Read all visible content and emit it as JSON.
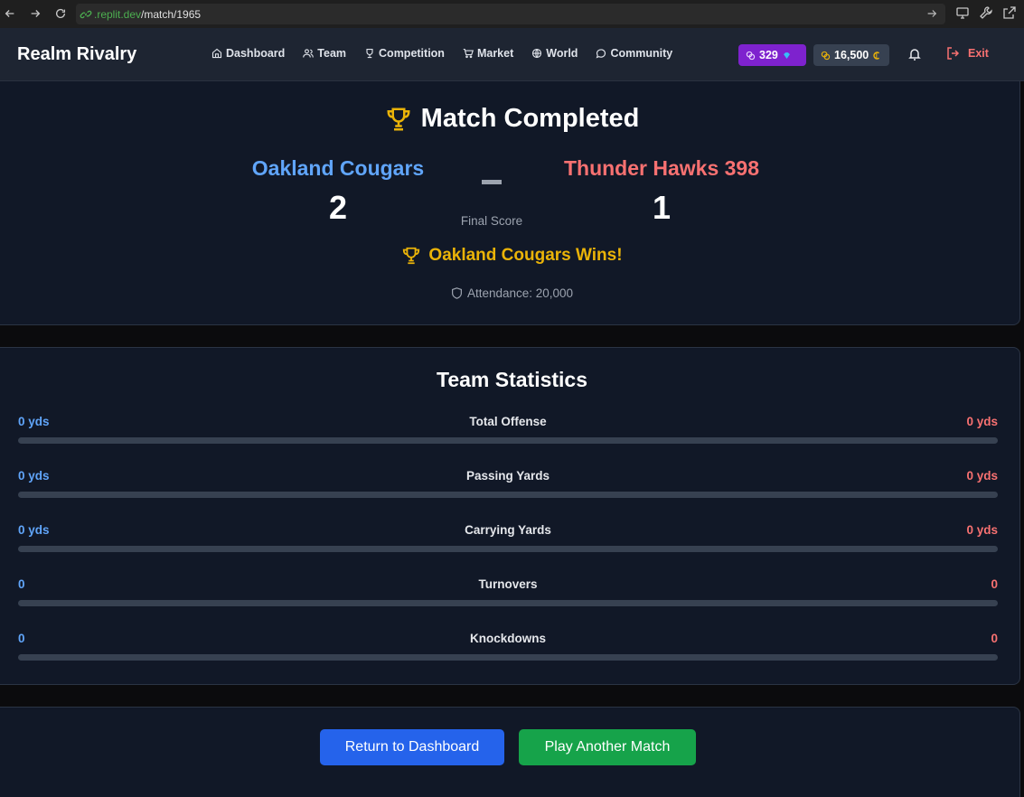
{
  "browser": {
    "url_domain": ".replit.dev",
    "url_path": "/match/1965"
  },
  "header": {
    "brand": "Realm Rivalry",
    "nav": [
      {
        "label": "Dashboard",
        "icon": "home-icon"
      },
      {
        "label": "Team",
        "icon": "users-icon"
      },
      {
        "label": "Competition",
        "icon": "trophy-icon"
      },
      {
        "label": "Market",
        "icon": "cart-icon"
      },
      {
        "label": "World",
        "icon": "globe-icon"
      },
      {
        "label": "Community",
        "icon": "chat-icon"
      }
    ],
    "gems": "329",
    "coins": "16,500",
    "exit_label": "Exit",
    "gems_color": "#7e22ce",
    "coins_icon_color": "#eab308"
  },
  "match": {
    "title": "Match Completed",
    "home_team": "Oakland Cougars",
    "away_team": "Thunder Hawks 398",
    "home_score": "2",
    "away_score": "1",
    "final_score_label": "Final Score",
    "winner_text": "Oakland Cougars Wins!",
    "attendance": "Attendance: 20,000",
    "home_color": "#60a5fa",
    "away_color": "#f87171",
    "accent_color": "#eab308"
  },
  "stats": {
    "title": "Team Statistics",
    "rows": [
      {
        "label": "Total Offense",
        "home": "0 yds",
        "away": "0 yds"
      },
      {
        "label": "Passing Yards",
        "home": "0 yds",
        "away": "0 yds"
      },
      {
        "label": "Carrying Yards",
        "home": "0 yds",
        "away": "0 yds"
      },
      {
        "label": "Turnovers",
        "home": "0",
        "away": "0"
      },
      {
        "label": "Knockdowns",
        "home": "0",
        "away": "0"
      }
    ]
  },
  "actions": {
    "return_label": "Return to Dashboard",
    "play_label": "Play Another Match",
    "return_color": "#2563eb",
    "play_color": "#16a34a"
  }
}
